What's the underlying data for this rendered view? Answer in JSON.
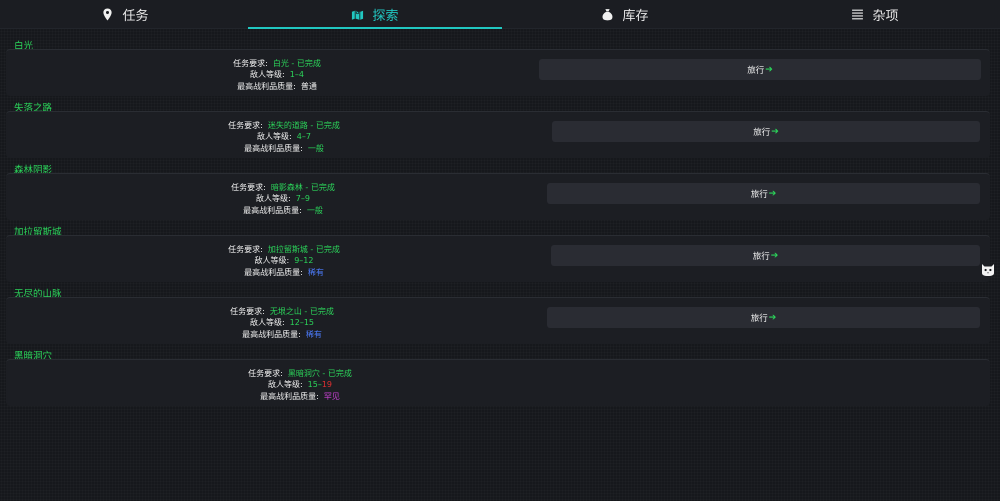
{
  "nav": {
    "tabs": [
      {
        "label": "任务",
        "icon": "map-pin-icon"
      },
      {
        "label": "探索",
        "icon": "map-icon"
      },
      {
        "label": "库存",
        "icon": "money-bag-icon"
      },
      {
        "label": "杂项",
        "icon": "list-icon"
      }
    ],
    "active": "探索"
  },
  "labels": {
    "requirement": "任务要求:",
    "enemy_level": "敌人等级:",
    "max_loot": "最高战利品质量:",
    "travel": "旅行"
  },
  "locations": [
    {
      "name": "白光",
      "requirement": "白光 - 已完成",
      "level_min": "1",
      "level_max": "4",
      "loot": "普通",
      "loot_color": "#f5f5f5",
      "has_travel": true
    },
    {
      "name": "失落之路",
      "requirement": "迷失的道路 - 已完成",
      "level_min": "4",
      "level_max": "7",
      "loot": "一般",
      "loot_color": "#2bd45a",
      "has_travel": true
    },
    {
      "name": "森林阴影",
      "requirement": "暗影森林 - 已完成",
      "level_min": "7",
      "level_max": "9",
      "loot": "一般",
      "loot_color": "#2bd45a",
      "has_travel": true
    },
    {
      "name": "加拉留斯城",
      "requirement": "加拉留斯城 - 已完成",
      "level_min": "9",
      "level_max": "12",
      "loot": "稀有",
      "loot_color": "#4d7dff",
      "has_travel": true
    },
    {
      "name": "无尽的山脉",
      "requirement": "无垠之山 - 已完成",
      "level_min": "12",
      "level_max": "15",
      "loot": "稀有",
      "loot_color": "#4d7dff",
      "has_travel": true
    },
    {
      "name": "黑暗洞穴",
      "requirement": "黑暗洞穴 - 已完成",
      "level_min": "15",
      "level_max": "19",
      "loot": "罕见",
      "loot_color": "#c640d2",
      "has_travel": false
    }
  ]
}
